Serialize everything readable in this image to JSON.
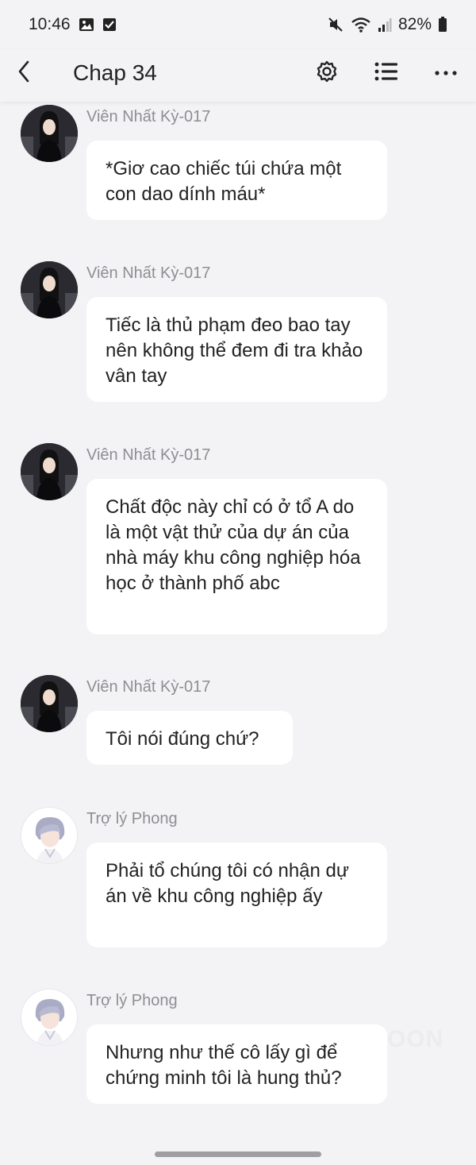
{
  "status_bar": {
    "time": "10:46",
    "battery": "82%",
    "icons": [
      "gallery-icon",
      "check-square-icon",
      "mute-icon",
      "wifi-icon",
      "signal-icon",
      "battery-icon"
    ]
  },
  "app_bar": {
    "title": "Chap 34",
    "icons": [
      "back-arrow-icon",
      "settings-gear-icon",
      "list-icon",
      "more-dots-icon"
    ]
  },
  "messages": [
    {
      "sender": "Viên Nhất Kỳ-017",
      "text": "*Giơ cao chiếc túi chứa một con dao dính máu*",
      "avatar": "avatar-dark"
    },
    {
      "sender": "Viên Nhất Kỳ-017",
      "text": "Tiếc là thủ phạm đeo bao tay nên không thể đem đi tra khảo vân tay",
      "avatar": "avatar-dark"
    },
    {
      "sender": "Viên Nhất Kỳ-017",
      "text": "Chất độc này chỉ có ở tổ A do là một vật thử của dự án của nhà máy khu công nghiệp hóa học ở thành phố abc",
      "avatar": "avatar-dark"
    },
    {
      "sender": "Viên Nhất Kỳ-017",
      "text": "Tôi nói đúng chứ?",
      "avatar": "avatar-dark"
    },
    {
      "sender": "Trợ lý Phong",
      "text": "Phải tổ chúng tôi có nhận dự án về khu công nghiệp ấy",
      "avatar": "avatar-light"
    },
    {
      "sender": "Trợ lý Phong",
      "text": "Nhưng như thế cô lấy gì để chứng minh tôi là hung thủ?",
      "avatar": "avatar-light"
    }
  ],
  "watermark": "OON",
  "colors": {
    "background": "#f3f3f5",
    "bubble": "#ffffff",
    "sender": "#8e8e93",
    "text": "#222222"
  }
}
